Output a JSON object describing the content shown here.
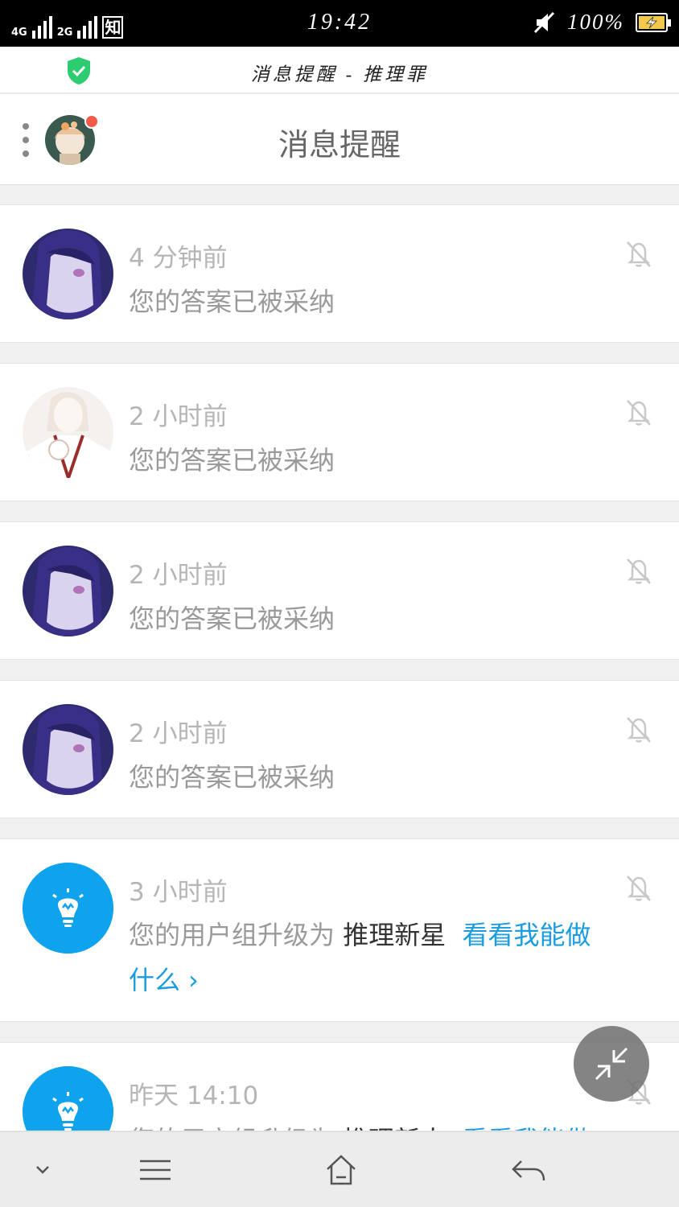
{
  "status_bar": {
    "network_1": "4G",
    "network_2": "4G",
    "network_3": "2G",
    "app_badge": "知",
    "time": "19:42",
    "battery_percent": "100%",
    "battery_level": 1.0
  },
  "browser": {
    "title": "消息提醒 - 推理罪",
    "secure_icon": "shield-check-icon"
  },
  "header": {
    "title": "消息提醒",
    "has_unread_dot": true
  },
  "notifications": [
    {
      "time": "4 分钟前",
      "message": "您的答案已被采纳",
      "avatar": "anime-girl-purple"
    },
    {
      "time": "2 小时前",
      "message": "您的答案已被采纳",
      "avatar": "anime-girl-white"
    },
    {
      "time": "2 小时前",
      "message": "您的答案已被采纳",
      "avatar": "anime-girl-purple"
    },
    {
      "time": "2 小时前",
      "message": "您的答案已被采纳",
      "avatar": "anime-girl-purple"
    },
    {
      "time": "3 小时前",
      "message_prefix": "您的用户组升级为",
      "group": "推理新星",
      "link": "看看我能做什么 ›",
      "avatar": "lightbulb-icon"
    },
    {
      "time": "昨天 14:10",
      "message_prefix": "您的用户组升级为",
      "group": "推理新人",
      "link": "看看我能做",
      "avatar": "lightbulb-icon"
    }
  ],
  "colors": {
    "accent": "#1a9de0",
    "unread": "#f25a4a",
    "secure": "#2ecc71"
  }
}
